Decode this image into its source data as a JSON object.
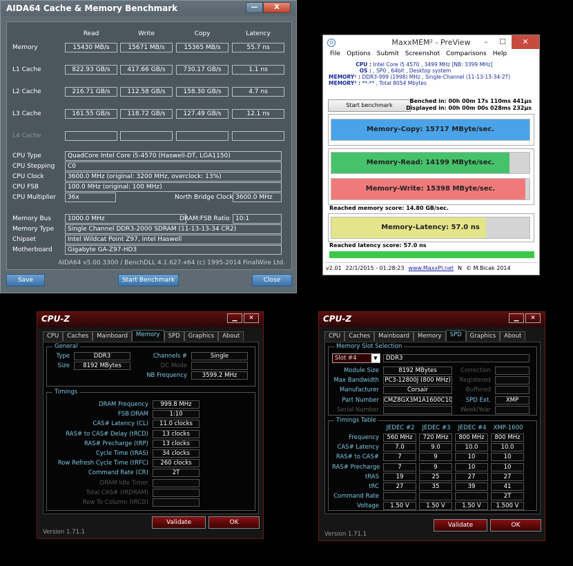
{
  "aida": {
    "title": "AIDA64 Cache & Memory Benchmark",
    "min_label": "—",
    "close_label": "X",
    "headers": [
      "Read",
      "Write",
      "Copy",
      "Latency"
    ],
    "rows": [
      {
        "label": "Memory",
        "values": [
          "15430 MB/s",
          "15671 MB/s",
          "15365 MB/s",
          "55.7 ns"
        ]
      },
      {
        "label": "L1 Cache",
        "values": [
          "822.93 GB/s",
          "417.66 GB/s",
          "730.17 GB/s",
          "1.1 ns"
        ]
      },
      {
        "label": "L2 Cache",
        "values": [
          "216.71 GB/s",
          "112.58 GB/s",
          "158.30 GB/s",
          "4.7 ns"
        ]
      },
      {
        "label": "L3 Cache",
        "values": [
          "161.55 GB/s",
          "118.72 GB/s",
          "127.49 GB/s",
          "12.1 ns"
        ]
      },
      {
        "label": "L4 Cache",
        "values": [
          "",
          "",
          "",
          ""
        ]
      }
    ],
    "cpu_type_label": "CPU Type",
    "cpu_type": "QuadCore Intel Core i5-4570  (Haswell-DT, LGA1150)",
    "cpu_stepping_label": "CPU Stepping",
    "cpu_stepping": "C0",
    "cpu_clock_label": "CPU Clock",
    "cpu_clock": "3600.0 MHz  (original: 3200 MHz, overclock: 13%)",
    "cpu_fsb_label": "CPU FSB",
    "cpu_fsb": "100.0 MHz  (original: 100 MHz)",
    "cpu_mult_label": "CPU Multiplier",
    "cpu_mult": "36x",
    "nb_clock_label": "North Bridge Clock",
    "nb_clock": "3600.0 MHz",
    "mem_bus_label": "Memory Bus",
    "mem_bus": "1000.0 MHz",
    "dram_ratio_label": "DRAM:FSB Ratio",
    "dram_ratio": "10:1",
    "mem_type_label": "Memory Type",
    "mem_type": "Single Channel DDR3-2000 SDRAM  (11-13-13-34 CR2)",
    "chipset_label": "Chipset",
    "chipset": "Intel Wildcat Point Z97, Intel Haswell",
    "mobo_label": "Motherboard",
    "mobo": "Gigabyte GA-Z97-HD3",
    "footer": "AIDA64 v5.00.3300 / BenchDLL 4.1.627-x64  (c) 1995-2014 FinalWire Ltd.",
    "save_label": "Save",
    "start_label": "Start Benchmark",
    "close_btn_label": "Close"
  },
  "maxx": {
    "title": "MaxxMEM² - PreView",
    "icon": "ʘ",
    "min": "–",
    "max": "☐",
    "close": "✕",
    "menu": [
      "File",
      "Options",
      "Submit",
      "Screenshot",
      "Comparisons",
      "Help"
    ],
    "cpu_k": "CPU :",
    "cpu_v": "Intel Core i5 4570 , 3499 MHz  [NB: 3399 MHz]",
    "os_k": "OS :",
    "os_v": ", SP0 , 64bit , Desktop system",
    "mem1_k": "MEMORY¹ :",
    "mem1_v": "DDR3-999 (1998) MHz , Single-Channel (11-13-13-34-2T)",
    "mem2_k": "MEMORY² :",
    "mem2_v": "**-** , Total 8054 Mbytes",
    "start_label": "Start benchmark",
    "benched": "Benched in: 00h 00m 17s 110ms 441µs",
    "displayed": "Displayed in: 00h 00m 00s 028ms 232µs",
    "copy_label": "Memory-Copy: 15717 MByte/sec.",
    "read_label": "Memory-Read: 14199 MByte/sec.",
    "write_label": "Memory-Write: 15398 MByte/sec.",
    "mem_score": "Reached memory score: 14.80 GB/sec.",
    "latency_label": "Memory-Latency: 57.0 ns",
    "lat_score": "Reached latency score: 57.0 ns",
    "version": "v2.01",
    "datetime": "22/1/2015 - 01:28:23",
    "url": "www.MaxxPI.net",
    "n": "N",
    "copyright": "© M.Bicak 2014",
    "levels": {
      "copy": 1.0,
      "read": 0.9,
      "write": 0.98,
      "latency": 0.78,
      "lat_score": 1.0
    },
    "colors": {
      "copy": "#4aa3e8",
      "read": "#46c36a",
      "write": "#f07a7a",
      "latency": "#e4e48a",
      "green": "#3cc84a"
    }
  },
  "cpuz1": {
    "title": "CPU-Z",
    "tabs": [
      "CPU",
      "Caches",
      "Mainboard",
      "Memory",
      "SPD",
      "Graphics",
      "About"
    ],
    "active_tab": 3,
    "general_title": "General",
    "type_label": "Type",
    "type": "DDR3",
    "size_label": "Size",
    "size": "8192 MBytes",
    "channels_label": "Channels #",
    "channels": "Single",
    "dc_label": "DC Mode",
    "dc": "",
    "nbfreq_label": "NB Frequency",
    "nbfreq": "3599.2 MHz",
    "timings_title": "Timings",
    "timings": [
      {
        "label": "DRAM Frequency",
        "value": "999.8 MHz",
        "dim": false
      },
      {
        "label": "FSB:DRAM",
        "value": "1:10",
        "dim": false
      },
      {
        "label": "CAS# Latency (CL)",
        "value": "11.0 clocks",
        "dim": false
      },
      {
        "label": "RAS# to CAS# Delay (tRCD)",
        "value": "13 clocks",
        "dim": false
      },
      {
        "label": "RAS# Precharge (tRP)",
        "value": "13 clocks",
        "dim": false
      },
      {
        "label": "Cycle Time (tRAS)",
        "value": "34 clocks",
        "dim": false
      },
      {
        "label": "Row Refresh Cycle Time (tRFC)",
        "value": "260 clocks",
        "dim": false
      },
      {
        "label": "Command Rate (CR)",
        "value": "2T",
        "dim": false
      },
      {
        "label": "DRAM Idle Timer",
        "value": "",
        "dim": true
      },
      {
        "label": "Total CAS# (tRDRAM)",
        "value": "",
        "dim": true
      },
      {
        "label": "Row To Column (tRCD)",
        "value": "",
        "dim": true
      }
    ],
    "validate_label": "Validate",
    "ok_label": "OK",
    "version": "Version 1.71.1"
  },
  "cpuz2": {
    "title": "CPU-Z",
    "tabs": [
      "CPU",
      "Caches",
      "Mainboard",
      "Memory",
      "SPD",
      "Graphics",
      "About"
    ],
    "active_tab": 4,
    "slot_title": "Memory Slot Selection",
    "slot": "Slot #4",
    "slot_type": "DDR3",
    "rows": [
      {
        "label": "Module Size",
        "value": "8192 MBytes",
        "rlabel": "Correction",
        "rvalue": ""
      },
      {
        "label": "Max Bandwidth",
        "value": "PC3-12800J (800 MHz)",
        "rlabel": "Registered",
        "rvalue": ""
      },
      {
        "label": "Manufacturer",
        "value": "Corsair",
        "rlabel": "Buffered",
        "rvalue": ""
      },
      {
        "label": "Part Number",
        "value": "CMZ8GX3M1A1600C10",
        "rlabel": "SPD Ext.",
        "rvalue": "XMP"
      },
      {
        "label": "Serial Number",
        "value": "",
        "rlabel": "Week/Year",
        "rvalue": ""
      }
    ],
    "timings_title": "Timings Table",
    "cols": [
      "JEDEC #2",
      "JEDEC #3",
      "JEDEC #4",
      "XMP-1600"
    ],
    "trows": [
      {
        "label": "Frequency",
        "values": [
          "560 MHz",
          "720 MHz",
          "800 MHz",
          "800 MHz"
        ]
      },
      {
        "label": "CAS# Latency",
        "values": [
          "7.0",
          "9.0",
          "10.0",
          "10.0"
        ]
      },
      {
        "label": "RAS# to CAS#",
        "values": [
          "7",
          "9",
          "10",
          "10"
        ]
      },
      {
        "label": "RAS# Precharge",
        "values": [
          "7",
          "9",
          "10",
          "10"
        ]
      },
      {
        "label": "tRAS",
        "values": [
          "19",
          "25",
          "27",
          "27"
        ]
      },
      {
        "label": "tRC",
        "values": [
          "27",
          "35",
          "39",
          "41"
        ]
      },
      {
        "label": "Command Rate",
        "values": [
          "",
          "",
          "",
          "2T"
        ]
      },
      {
        "label": "Voltage",
        "values": [
          "1.50 V",
          "1.50 V",
          "1.50 V",
          "1.500 V"
        ]
      }
    ],
    "validate_label": "Validate",
    "ok_label": "OK",
    "version": "Version 1.71.1"
  }
}
